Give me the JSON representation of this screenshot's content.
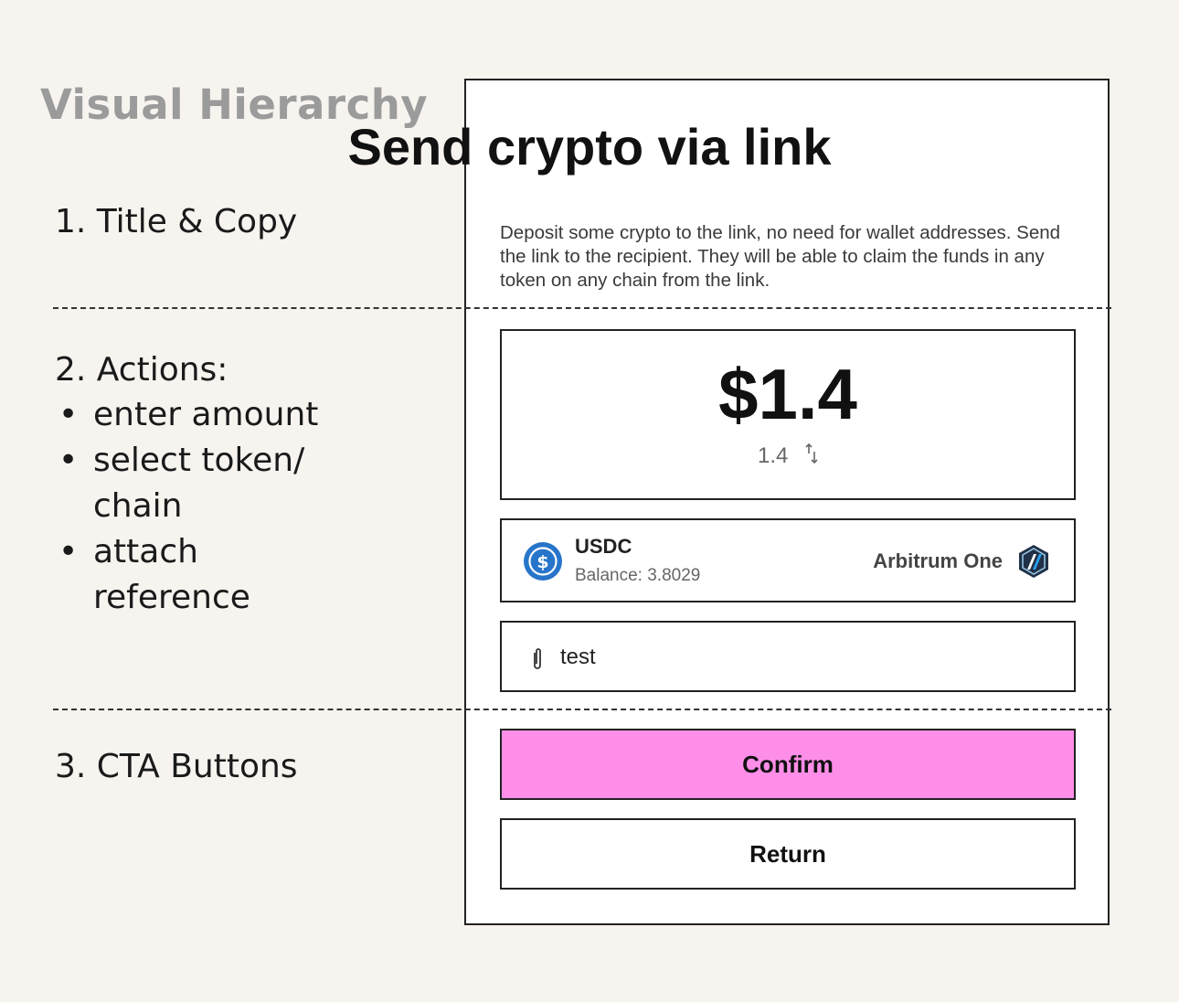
{
  "annotations": {
    "heading": "Visual Hierarchy",
    "section1": "1. Title & Copy",
    "section2": "2. Actions:",
    "section2_items": [
      "enter amount",
      "select token/ chain",
      "attach reference"
    ],
    "section3": "3. CTA Buttons",
    "bullet": "•"
  },
  "card": {
    "title": "Send crypto via link",
    "description": "Deposit some crypto to the link, no need for wallet addresses. Send the link to the recipient. They will be able to claim the funds in any token on any chain from the link."
  },
  "amount": {
    "value": "$1.4",
    "token_amount": "1.4",
    "swap_icon": "swap-vertical-icon"
  },
  "token": {
    "symbol": "USDC",
    "balance": "Balance: 3.8029",
    "chain": "Arbitrum One",
    "token_icon": "usdc-icon",
    "chain_icon": "arbitrum-icon"
  },
  "reference": {
    "value": "test",
    "icon": "paperclip-icon"
  },
  "buttons": {
    "confirm": "Confirm",
    "return": "Return"
  },
  "colors": {
    "background": "#f7f3ef",
    "confirm_button": "#ff8ee8",
    "usdc_blue": "#2775ca",
    "arbitrum_blue": "#28a0f0",
    "heading_gray": "#9b9b9b"
  }
}
